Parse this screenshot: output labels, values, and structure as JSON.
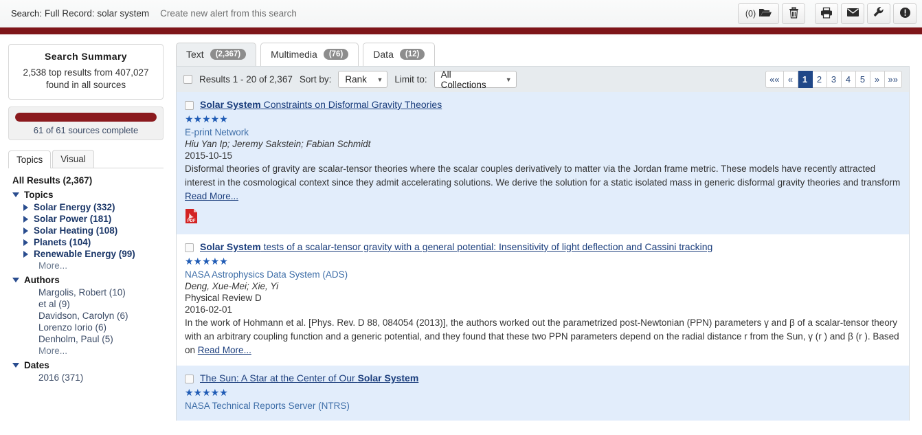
{
  "header": {
    "search_label": "Search:",
    "query": "Full Record: solar system",
    "create_alert": "Create new alert from this search",
    "toolbar": {
      "folder_count": "(0)",
      "folder_icon": "folder-open-icon",
      "delete_icon": "trash-icon",
      "print_icon": "printer-icon",
      "email_icon": "envelope-icon",
      "tools_icon": "wrench-icon",
      "alert_icon": "exclamation-circle-icon"
    }
  },
  "sidebar": {
    "summary": {
      "title": "Search Summary",
      "line1": "2,538 top results from 407,027",
      "line2": "found in all sources"
    },
    "progress": {
      "label": "61 of 61 sources complete",
      "percent": 100,
      "color": "#8b1a1e"
    },
    "tabs": [
      {
        "label": "Topics",
        "active": true
      },
      {
        "label": "Visual",
        "active": false
      }
    ],
    "all_results": "All Results (2,367)",
    "groups": [
      {
        "name": "Topics",
        "expanded": true,
        "items": [
          {
            "label": "Solar Energy (332)",
            "expandable": true
          },
          {
            "label": "Solar Power (181)",
            "expandable": true
          },
          {
            "label": "Solar Heating (108)",
            "expandable": true
          },
          {
            "label": "Planets (104)",
            "expandable": true
          },
          {
            "label": "Renewable Energy (99)",
            "expandable": true
          }
        ],
        "more": "More..."
      },
      {
        "name": "Authors",
        "expanded": true,
        "items": [
          {
            "label": "Margolis, Robert (10)",
            "expandable": false
          },
          {
            "label": "et al (9)",
            "expandable": false
          },
          {
            "label": "Davidson, Carolyn (6)",
            "expandable": false
          },
          {
            "label": "Lorenzo Iorio (6)",
            "expandable": false
          },
          {
            "label": "Denholm, Paul (5)",
            "expandable": false
          }
        ],
        "more": "More..."
      },
      {
        "name": "Dates",
        "expanded": true,
        "items": [
          {
            "label": "2016 (371)",
            "expandable": false
          }
        ],
        "more": ""
      }
    ]
  },
  "main": {
    "tabs": [
      {
        "label": "Text",
        "count": "(2,367)",
        "active": true
      },
      {
        "label": "Multimedia",
        "count": "(76)",
        "active": false
      },
      {
        "label": "Data",
        "count": "(12)",
        "active": false
      }
    ],
    "toolbar": {
      "results_text": "Results 1 - 20 of 2,367",
      "sort_label": "Sort by:",
      "sort_value": "Rank",
      "limit_label": "Limit to:",
      "limit_value": "All Collections"
    },
    "pagination": {
      "first": "««",
      "prev": "«",
      "pages": [
        "1",
        "2",
        "3",
        "4",
        "5"
      ],
      "active_page": "1",
      "next": "»",
      "last": "»»"
    },
    "results": [
      {
        "title_bold": "Solar System",
        "title_rest": " Constraints on Disformal Gravity Theories",
        "title_bold_first": true,
        "rating": 5,
        "source": "E-print Network",
        "authors": "Hiu Yan Ip; Jeremy Sakstein; Fabian Schmidt",
        "date": "2015-10-15",
        "journal": "",
        "abstract": "Disformal theories of gravity are scalar-tensor theories where the scalar couples derivatively to matter via the Jordan frame metric. These models have recently attracted interest in the cosmological context since they admit accelerating solutions. We derive the solution for a static isolated mass in generic disformal gravity theories and transform",
        "read_more": "Read More...",
        "has_pdf": true,
        "highlight": true
      },
      {
        "title_bold": "Solar System",
        "title_rest": " tests of a scalar-tensor gravity with a general potential: Insensitivity of light deflection and Cassini tracking",
        "title_bold_first": true,
        "rating": 5,
        "source": "NASA Astrophysics Data System (ADS)",
        "authors": "Deng, Xue-Mei; Xie, Yi",
        "date": "2016-02-01",
        "journal": "Physical Review D",
        "abstract": "In the work of Hohmann et al. [Phys. Rev. D 88, 084054 (2013)], the authors worked out the parametrized post-Newtonian (PPN) parameters γ and β of a scalar-tensor theory with an arbitrary coupling function and a generic potential, and they found that these two PPN parameters depend on the radial distance r from the Sun, γ (r ) and β (r ). Based on",
        "read_more": "Read More...",
        "has_pdf": false,
        "highlight": false
      },
      {
        "title_bold": "Solar System",
        "title_rest": "The Sun: A Star at the Center of Our ",
        "title_bold_first": false,
        "rating": 5,
        "source": "NASA Technical Reports Server (NTRS)",
        "authors": "",
        "date": "",
        "journal": "",
        "abstract": "",
        "read_more": "",
        "has_pdf": false,
        "highlight": true
      }
    ]
  }
}
